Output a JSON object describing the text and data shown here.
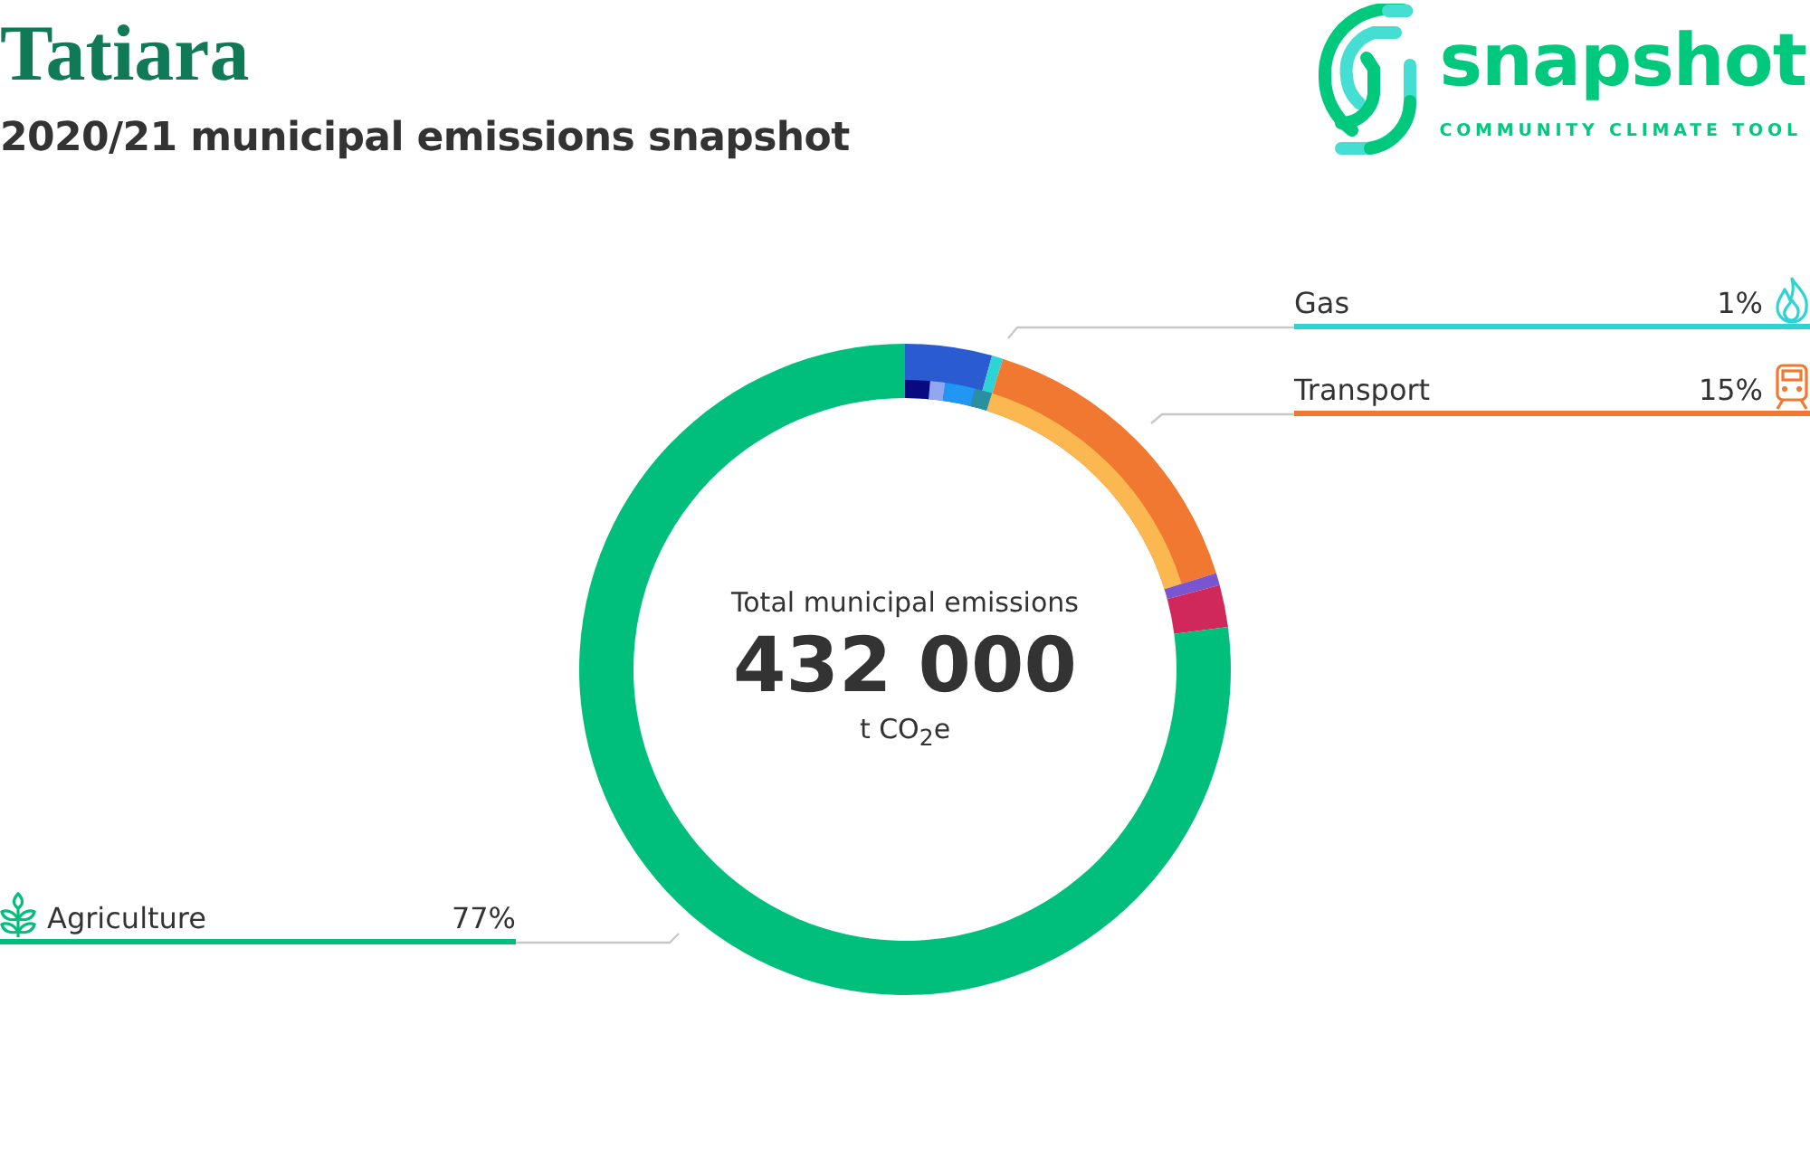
{
  "header": {
    "title": "Tatiara",
    "subtitle": "2020/21 municipal emissions snapshot"
  },
  "logo": {
    "wordmark": "snapshot",
    "tagline": "COMMUNITY CLIMATE TOOL"
  },
  "donut": {
    "caption": "Total municipal emissions",
    "total": "432 000",
    "unit": "t CO$_{2}$e"
  },
  "callouts": [
    {
      "kind": "gas",
      "label": "Gas",
      "value": "1%",
      "color": "#2ed3d3"
    },
    {
      "kind": "transport",
      "label": "Transport",
      "value": "15%",
      "color": "#f07830"
    },
    {
      "kind": "agriculture",
      "label": "Agriculture",
      "value": "77%",
      "color": "#00bf7d"
    }
  ]
}
